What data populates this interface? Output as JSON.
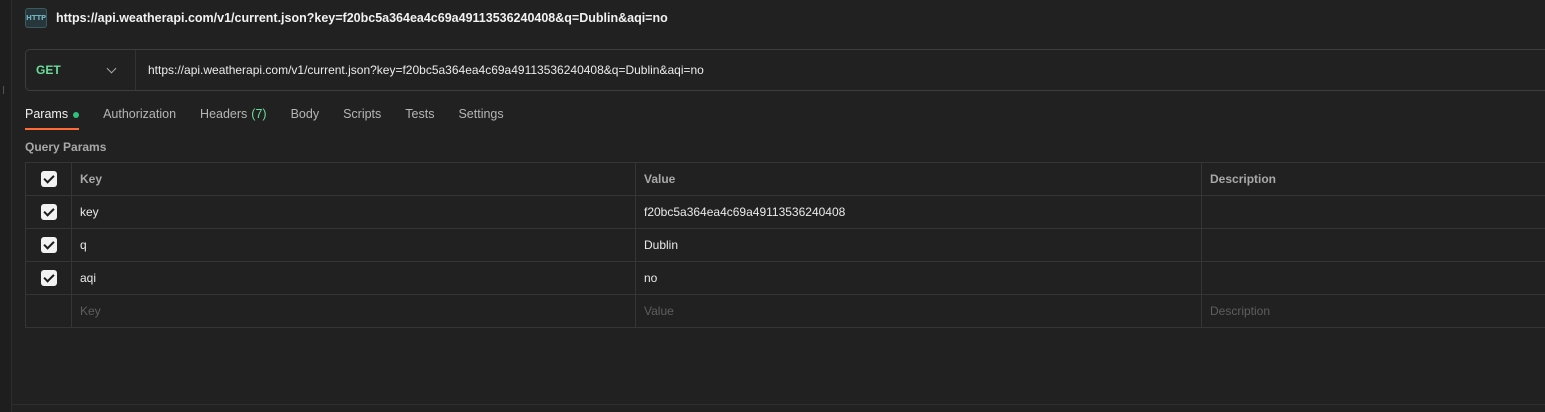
{
  "tab": {
    "icon": "http-icon",
    "icon_text": "HTTP",
    "title": "https://api.weatherapi.com/v1/current.json?key=f20bc5a364ea4c69a49113536240408&q=Dublin&aqi=no"
  },
  "request": {
    "method": "GET",
    "url": "https://api.weatherapi.com/v1/current.json?key=f20bc5a364ea4c69a49113536240408&q=Dublin&aqi=no"
  },
  "tabs": [
    {
      "label": "Params",
      "active": true,
      "dot": true
    },
    {
      "label": "Authorization"
    },
    {
      "label": "Headers",
      "count": "(7)"
    },
    {
      "label": "Body"
    },
    {
      "label": "Scripts"
    },
    {
      "label": "Tests"
    },
    {
      "label": "Settings"
    }
  ],
  "query_params": {
    "section_label": "Query Params",
    "columns": [
      "Key",
      "Value",
      "Description"
    ],
    "rows": [
      {
        "checked": true,
        "key": "key",
        "value": "f20bc5a364ea4c69a49113536240408",
        "description": ""
      },
      {
        "checked": true,
        "key": "q",
        "value": "Dublin",
        "description": ""
      },
      {
        "checked": true,
        "key": "aqi",
        "value": "no",
        "description": ""
      }
    ],
    "placeholder": {
      "key": "Key",
      "value": "Value",
      "description": "Description"
    }
  },
  "colors": {
    "method": "#6bdd9a",
    "active_tab_underline": "#ff6c37",
    "params_dot": "#2ec27e",
    "background": "#212121"
  }
}
